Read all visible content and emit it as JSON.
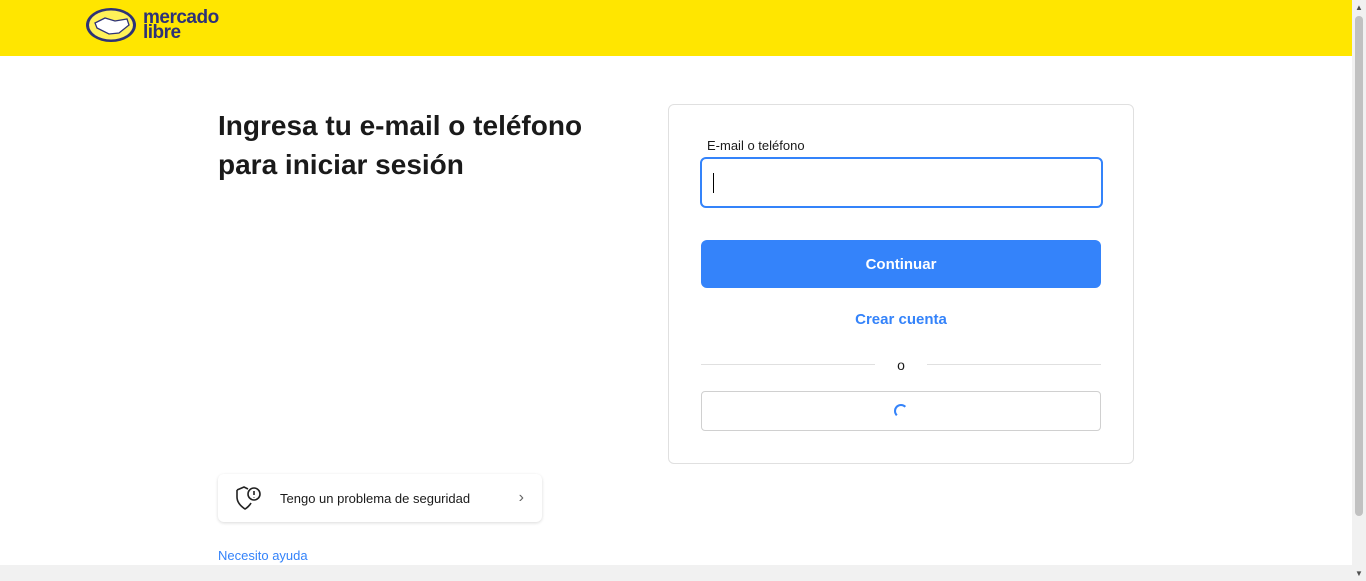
{
  "header": {
    "logo_text_1": "mercado",
    "logo_text_2": "libre",
    "brand_color": "#ffe600"
  },
  "title": "Ingresa tu e-mail o teléfono para iniciar sesión",
  "form": {
    "label": "E-mail o teléfono",
    "value": "",
    "continue": "Continuar",
    "create": "Crear cuenta",
    "separator": "o"
  },
  "security": {
    "label": "Tengo un problema de seguridad",
    "icon": "shield-alert-icon"
  },
  "help": "Necesito ayuda",
  "accent": "#3483fa"
}
